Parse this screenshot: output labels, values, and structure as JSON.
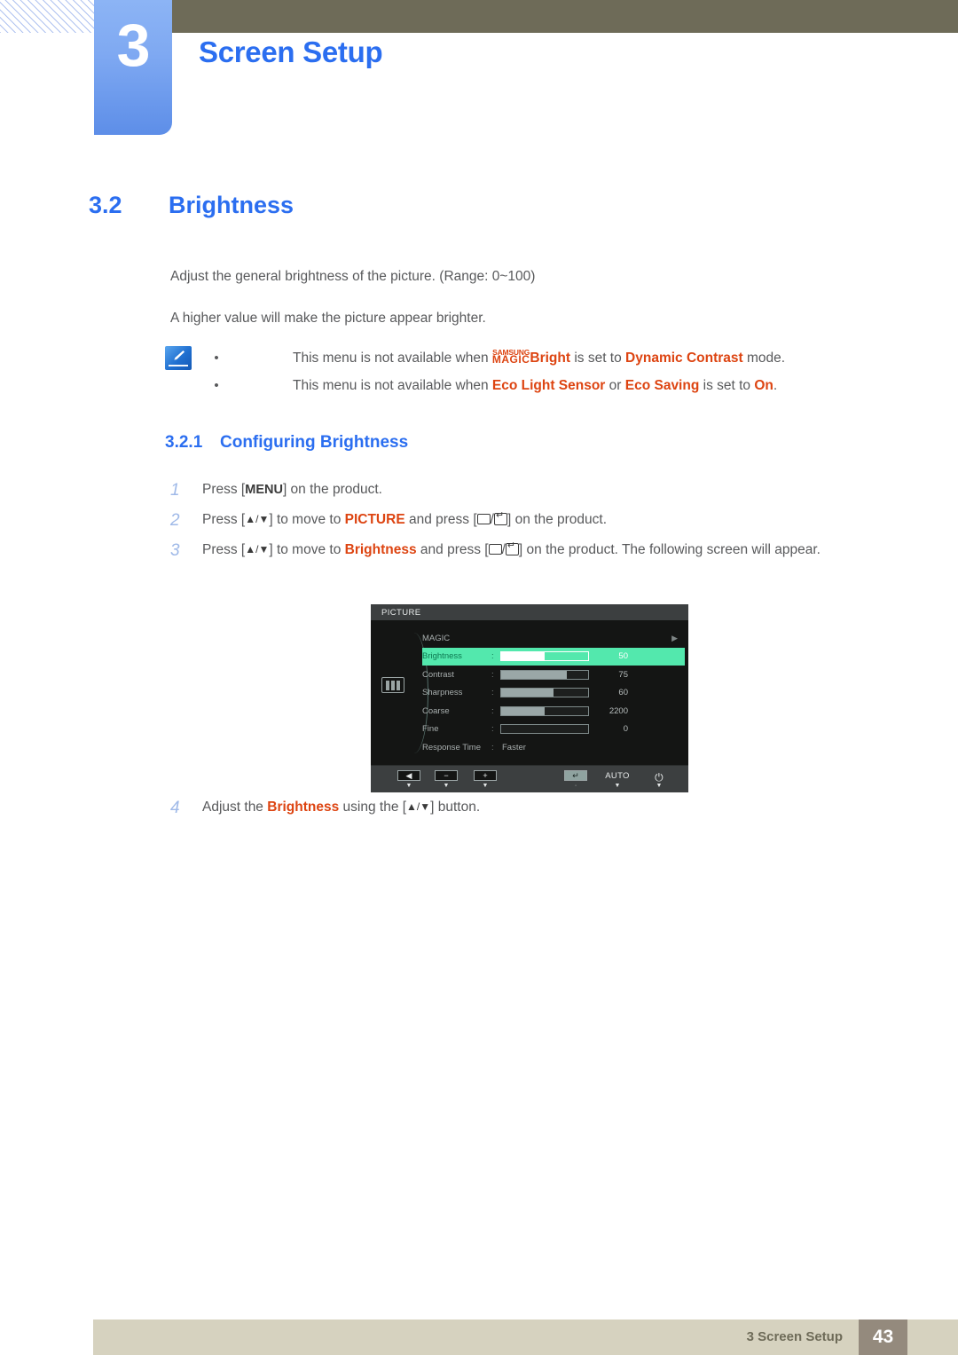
{
  "header": {
    "chapter_number": "3",
    "chapter_title": "Screen Setup"
  },
  "section": {
    "number": "3.2",
    "title": "Brightness",
    "paragraph_1": "Adjust the general brightness of the picture. (Range: 0~100)",
    "paragraph_2": "A higher value will make the picture appear brighter."
  },
  "note": {
    "icon": "note-pencil-icon",
    "items": [
      {
        "bullet": "•",
        "prefix": "This menu is not available when ",
        "logo_line1": "SAMSUNG",
        "logo_line2": "MAGIC",
        "logo_suffix": "Bright",
        "middle": " is set to ",
        "highlight": "Dynamic Contrast",
        "suffix": " mode."
      },
      {
        "bullet": "•",
        "prefix": "This menu is not available when ",
        "highlight_1": "Eco Light Sensor",
        "middle_1": " or ",
        "highlight_2": "Eco Saving",
        "middle_2": " is set to ",
        "highlight_3": "On",
        "suffix": "."
      }
    ]
  },
  "subsection": {
    "number": "3.2.1",
    "title": "Configuring Brightness"
  },
  "steps": [
    {
      "index": "1",
      "pre": "Press [",
      "key": "MENU",
      "post": "] on the product."
    },
    {
      "index": "2",
      "pre": "Press [",
      "arrows": "▲/▼",
      "mid1": "] to move to ",
      "highlight": "PICTURE",
      "mid2": " and press [",
      "mid3": "/",
      "post": "] on the product."
    },
    {
      "index": "3",
      "pre": "Press [",
      "arrows": "▲/▼",
      "mid1": "] to move to ",
      "highlight": "Brightness",
      "mid2": " and press [",
      "mid3": "/",
      "post": "] on the product. The following screen will appear."
    },
    {
      "index": "4",
      "pre": "Adjust the ",
      "highlight": "Brightness",
      "mid1": " using the [",
      "arrows": "▲/▼",
      "post": "] button."
    }
  ],
  "osd": {
    "title": "PICTURE",
    "side_icon": "picture-mode-icon",
    "rows": [
      {
        "label": "MAGIC",
        "type": "submenu",
        "arrow": "▶"
      },
      {
        "label": "Brightness",
        "type": "slider",
        "colon": ":",
        "value": "50",
        "fill_percent": 50,
        "selected": true
      },
      {
        "label": "Contrast",
        "type": "slider",
        "colon": ":",
        "value": "75",
        "fill_percent": 75,
        "selected": false
      },
      {
        "label": "Sharpness",
        "type": "slider",
        "colon": ":",
        "value": "60",
        "fill_percent": 60,
        "selected": false
      },
      {
        "label": "Coarse",
        "type": "slider",
        "colon": ":",
        "value": "2200",
        "fill_percent": 50,
        "selected": false
      },
      {
        "label": "Fine",
        "type": "slider",
        "colon": ":",
        "value": "0",
        "fill_percent": 0,
        "selected": false
      },
      {
        "label": "Response Time",
        "type": "text",
        "colon": ":",
        "value": "Faster"
      }
    ],
    "footer_buttons": [
      {
        "name": "back-button",
        "glyph": "◀",
        "caret": "▼"
      },
      {
        "name": "minus-button",
        "glyph": "−",
        "caret": "▼"
      },
      {
        "name": "plus-button",
        "glyph": "+",
        "caret": "▼"
      },
      {
        "name": "enter-button",
        "glyph": "↵",
        "caret": "·"
      },
      {
        "name": "auto-button",
        "glyph": "AUTO",
        "caret": "▼"
      },
      {
        "name": "power-button",
        "glyph": "⏻",
        "caret": "▼"
      }
    ]
  },
  "footer": {
    "label": "3 Screen Setup",
    "page": "43"
  },
  "colors": {
    "accent_blue": "#2b6ef0",
    "highlight_orange": "#dd4411",
    "olive": "#6e6b58",
    "footer_bg": "#d6d2bf",
    "page_badge": "#948a7d",
    "osd_select_green": "#53e8ad"
  }
}
